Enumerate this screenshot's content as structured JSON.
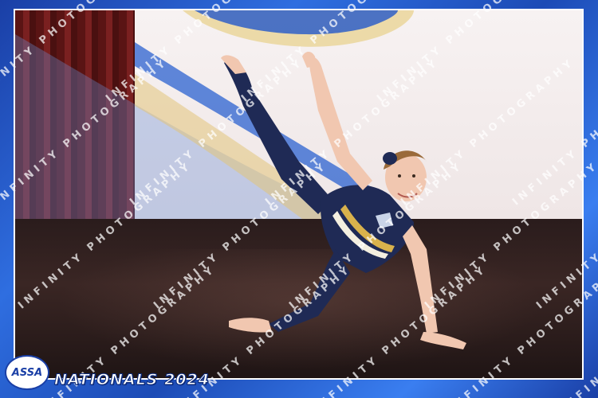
{
  "event": {
    "logo_text": "ASSA",
    "title": "NATIONALS 2024"
  },
  "watermark": {
    "text": "INFINITY PHOTOGRAPHY"
  },
  "colors": {
    "frame_blue": "#1d4fb8",
    "costume_navy": "#1f2a55",
    "accent_gold": "#d9b24c"
  }
}
